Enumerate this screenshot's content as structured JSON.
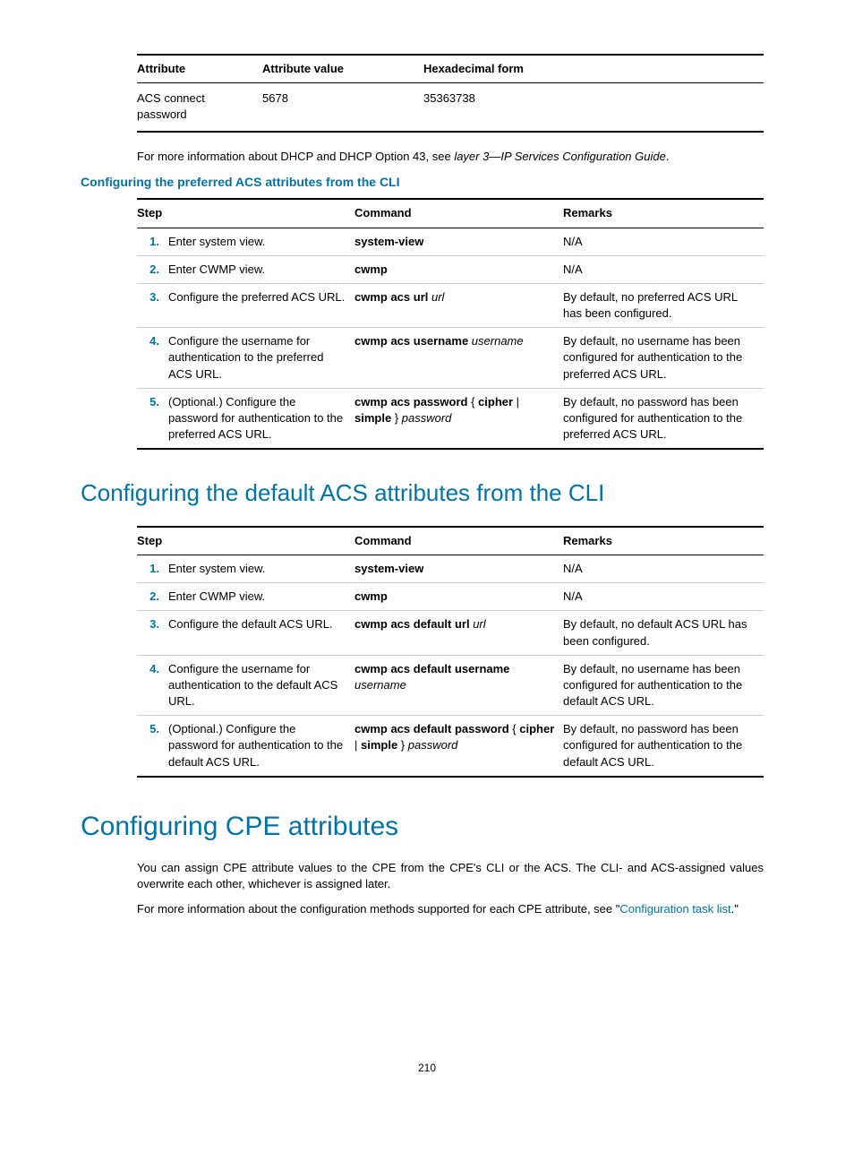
{
  "table1": {
    "headers": [
      "Attribute",
      "Attribute value",
      "Hexadecimal form"
    ],
    "row": {
      "attr": "ACS connect password",
      "val": "5678",
      "hex": "35363738"
    }
  },
  "dhcp_note": {
    "prefix": "For more information about DHCP and DHCP Option 43, see ",
    "italic": "layer 3—IP Services Configuration Guide",
    "suffix": "."
  },
  "heading_pref": "Configuring the preferred ACS attributes from the CLI",
  "steps_headers": {
    "step": "Step",
    "command": "Command",
    "remarks": "Remarks"
  },
  "pref_steps": [
    {
      "n": "1.",
      "desc": "Enter system view.",
      "cmd_bold": "system-view",
      "cmd_ital": "",
      "rem": "N/A"
    },
    {
      "n": "2.",
      "desc": "Enter CWMP view.",
      "cmd_bold": "cwmp",
      "cmd_ital": "",
      "rem": "N/A"
    },
    {
      "n": "3.",
      "desc": "Configure the preferred ACS URL.",
      "cmd_bold": "cwmp acs url ",
      "cmd_ital": "url",
      "rem": "By default, no preferred ACS URL has been configured."
    },
    {
      "n": "4.",
      "desc": "Configure the username for authentication to the preferred ACS URL.",
      "cmd_bold": "cwmp acs username ",
      "cmd_ital": "username",
      "rem": "By default, no username has been configured for authentication to the preferred ACS URL."
    },
    {
      "n": "5.",
      "desc": "(Optional.) Configure the password for authentication to the preferred ACS URL.",
      "cmd_parts": [
        {
          "t": "cwmp acs password",
          "b": true
        },
        {
          "t": " { ",
          "b": false
        },
        {
          "t": "cipher",
          "b": true
        },
        {
          "t": " | ",
          "b": false
        },
        {
          "t": "simple",
          "b": true
        },
        {
          "t": " } ",
          "b": false
        },
        {
          "t": "password",
          "i": true
        }
      ],
      "rem": "By default, no password has been configured for authentication to the preferred ACS URL."
    }
  ],
  "heading_default": "Configuring the default ACS attributes from the CLI",
  "def_steps": [
    {
      "n": "1.",
      "desc": "Enter system view.",
      "cmd_bold": "system-view",
      "cmd_ital": "",
      "rem": "N/A"
    },
    {
      "n": "2.",
      "desc": "Enter CWMP view.",
      "cmd_bold": "cwmp",
      "cmd_ital": "",
      "rem": "N/A"
    },
    {
      "n": "3.",
      "desc": "Configure the default ACS URL.",
      "cmd_bold": "cwmp acs default url ",
      "cmd_ital": "url",
      "rem": "By default, no default ACS URL has been configured."
    },
    {
      "n": "4.",
      "desc": "Configure the username for authentication to the default ACS URL.",
      "cmd_bold": "cwmp acs default username ",
      "cmd_ital": "username",
      "rem": "By default, no username has been configured for authentication to the default ACS URL."
    },
    {
      "n": "5.",
      "desc": "(Optional.) Configure the password for authentication to the default ACS URL.",
      "cmd_parts": [
        {
          "t": "cwmp acs default password",
          "b": true
        },
        {
          "t": " { ",
          "b": false
        },
        {
          "t": "cipher",
          "b": true
        },
        {
          "t": " | ",
          "b": false
        },
        {
          "t": "simple",
          "b": true
        },
        {
          "t": " } ",
          "b": false
        },
        {
          "t": "password",
          "i": true
        }
      ],
      "rem": "By default, no password has been configured for authentication to the default ACS URL."
    }
  ],
  "heading_cpe": "Configuring CPE attributes",
  "cpe_p1": "You can assign CPE attribute values to the CPE from the CPE's CLI or the ACS. The CLI- and ACS-assigned values overwrite each other, whichever is assigned later.",
  "cpe_p2_a": "For more information about the configuration methods supported for each CPE attribute, see \"",
  "cpe_p2_link": "Configuration task list",
  "cpe_p2_b": ".\"",
  "page_number": "210"
}
